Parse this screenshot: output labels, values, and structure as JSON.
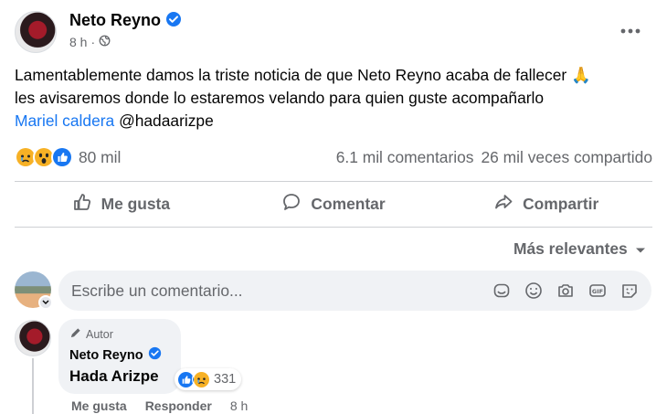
{
  "post": {
    "author": "Neto Reyno",
    "time": "8 h",
    "text_line1": "Lamentablemente damos la triste noticia de que Neto Reyno acaba de fallecer",
    "text_line2": "les avisaremos donde lo estaremos velando para quien guste acompañarlo",
    "mention_link": "Mariel caldera",
    "mention_handle": "@hadaarizpe",
    "pray_emoji": "🙏",
    "reactions": [
      "sad",
      "wow",
      "like"
    ],
    "reactions_count": "80 mil",
    "comments_count": "6.1 mil comentarios",
    "shares_count": "26 mil veces compartido"
  },
  "actions": {
    "like_label": "Me gusta",
    "comment_label": "Comentar",
    "share_label": "Compartir"
  },
  "comments_section": {
    "sort_label": "Más relevantes",
    "input_placeholder": "Escribe un comentario...",
    "input_icons": [
      "sticker-icon",
      "emoji-icon",
      "camera-icon",
      "gif-icon",
      "sticker-face-icon"
    ]
  },
  "comment": {
    "badge": "Autor",
    "author": "Neto Reyno",
    "text": "Hada Arizpe",
    "reactions_count": "331",
    "like_label": "Me gusta",
    "reply_label": "Responder",
    "time": "8 h"
  },
  "colors": {
    "brand_blue": "#1877f2",
    "secondary_text": "#65676b",
    "bubble_bg": "#f0f2f5"
  }
}
